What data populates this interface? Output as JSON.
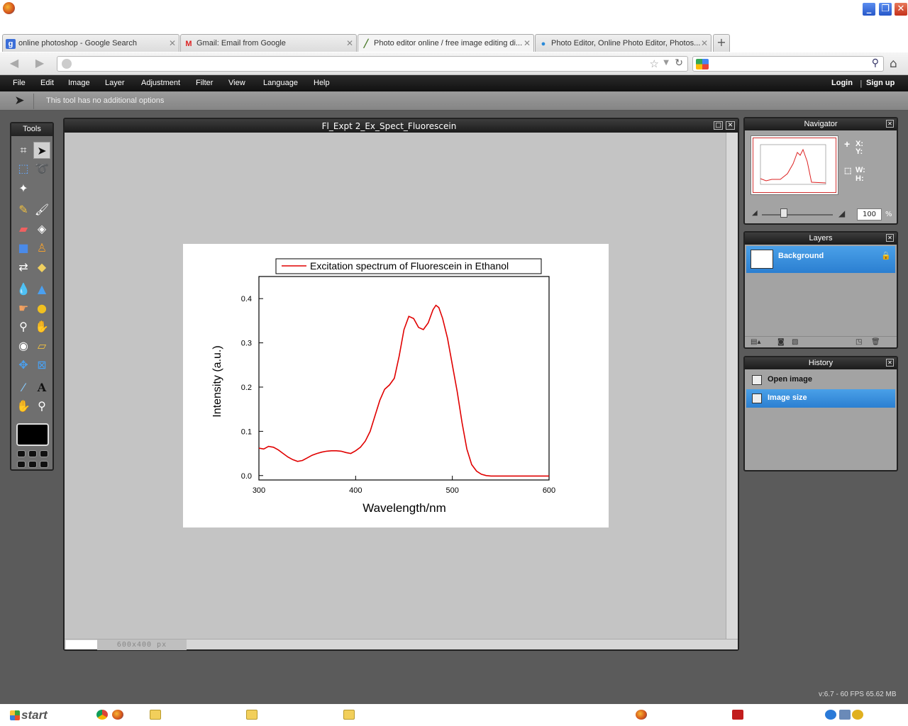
{
  "browser": {
    "tabs": [
      {
        "label": "online photoshop - Google Search",
        "icon": "google-icon"
      },
      {
        "label": "Gmail: Email from Google",
        "icon": "gmail-icon"
      },
      {
        "label": "Photo editor online / free image editing di...",
        "icon": "brush-icon",
        "active": true
      },
      {
        "label": "Photo Editor, Online Photo Editor, Photos...",
        "icon": "chat-bubble-icon"
      }
    ],
    "url": "",
    "search": ""
  },
  "app": {
    "menu": [
      "File",
      "Edit",
      "Image",
      "Layer",
      "Adjustment",
      "Filter",
      "View",
      "Language",
      "Help"
    ],
    "login": "Login",
    "signup": "Sign up",
    "menu_sep": "|",
    "tool_options_text": "This tool has no additional options",
    "tools_title": "Tools",
    "document": {
      "title": "Fl_Expt 2_Ex_Spect_Fluorescein",
      "size_label": "600x400 px"
    },
    "navigator": {
      "title": "Navigator",
      "x_label": "X:",
      "y_label": "Y:",
      "w_label": "W:",
      "h_label": "H:",
      "zoom": "100",
      "zoom_unit": "%"
    },
    "layers": {
      "title": "Layers",
      "items": [
        {
          "name": "Background",
          "locked": true
        }
      ]
    },
    "history": {
      "title": "History",
      "items": [
        "Open image",
        "Image size"
      ],
      "selected_index": 1
    },
    "version": "v:6.7 - 60 FPS 65.62 MB"
  },
  "taskbar": {
    "start_label": "start"
  },
  "colors": {
    "accent_blue": "#2b7fd1",
    "foreground_color": "#000000",
    "spectrum_line": "#e00000"
  },
  "chart_data": {
    "type": "line",
    "legend": "Excitation spectrum of Fluorescein in Ethanol",
    "xlabel": "Wavelength/nm",
    "ylabel": "Intensity (a.u.)",
    "xlim": [
      300,
      600
    ],
    "ylim": [
      -0.01,
      0.45
    ],
    "xticks": [
      300,
      400,
      500,
      600
    ],
    "yticks": [
      0.0,
      0.1,
      0.2,
      0.3,
      0.4
    ],
    "ytick_labels": [
      "0.0",
      "0.1",
      "0.2",
      "0.3",
      "0.4"
    ],
    "series": [
      {
        "name": "Excitation spectrum of Fluorescein in Ethanol",
        "x": [
          300,
          305,
          310,
          315,
          320,
          325,
          330,
          335,
          340,
          345,
          350,
          355,
          360,
          365,
          370,
          375,
          380,
          385,
          390,
          395,
          400,
          405,
          410,
          415,
          420,
          425,
          430,
          435,
          440,
          445,
          450,
          455,
          460,
          465,
          470,
          475,
          480,
          483,
          486,
          490,
          495,
          500,
          505,
          510,
          515,
          520,
          525,
          530,
          535,
          540,
          550,
          560,
          570,
          580,
          590,
          600
        ],
        "y": [
          0.062,
          0.06,
          0.066,
          0.064,
          0.058,
          0.05,
          0.042,
          0.036,
          0.032,
          0.034,
          0.04,
          0.046,
          0.05,
          0.053,
          0.055,
          0.056,
          0.056,
          0.055,
          0.052,
          0.05,
          0.056,
          0.064,
          0.078,
          0.1,
          0.135,
          0.17,
          0.195,
          0.205,
          0.22,
          0.27,
          0.33,
          0.36,
          0.355,
          0.335,
          0.33,
          0.345,
          0.375,
          0.385,
          0.38,
          0.355,
          0.31,
          0.25,
          0.19,
          0.12,
          0.06,
          0.025,
          0.01,
          0.003,
          0.0,
          -0.001,
          -0.001,
          -0.001,
          -0.001,
          -0.001,
          -0.001,
          -0.001
        ]
      }
    ]
  }
}
